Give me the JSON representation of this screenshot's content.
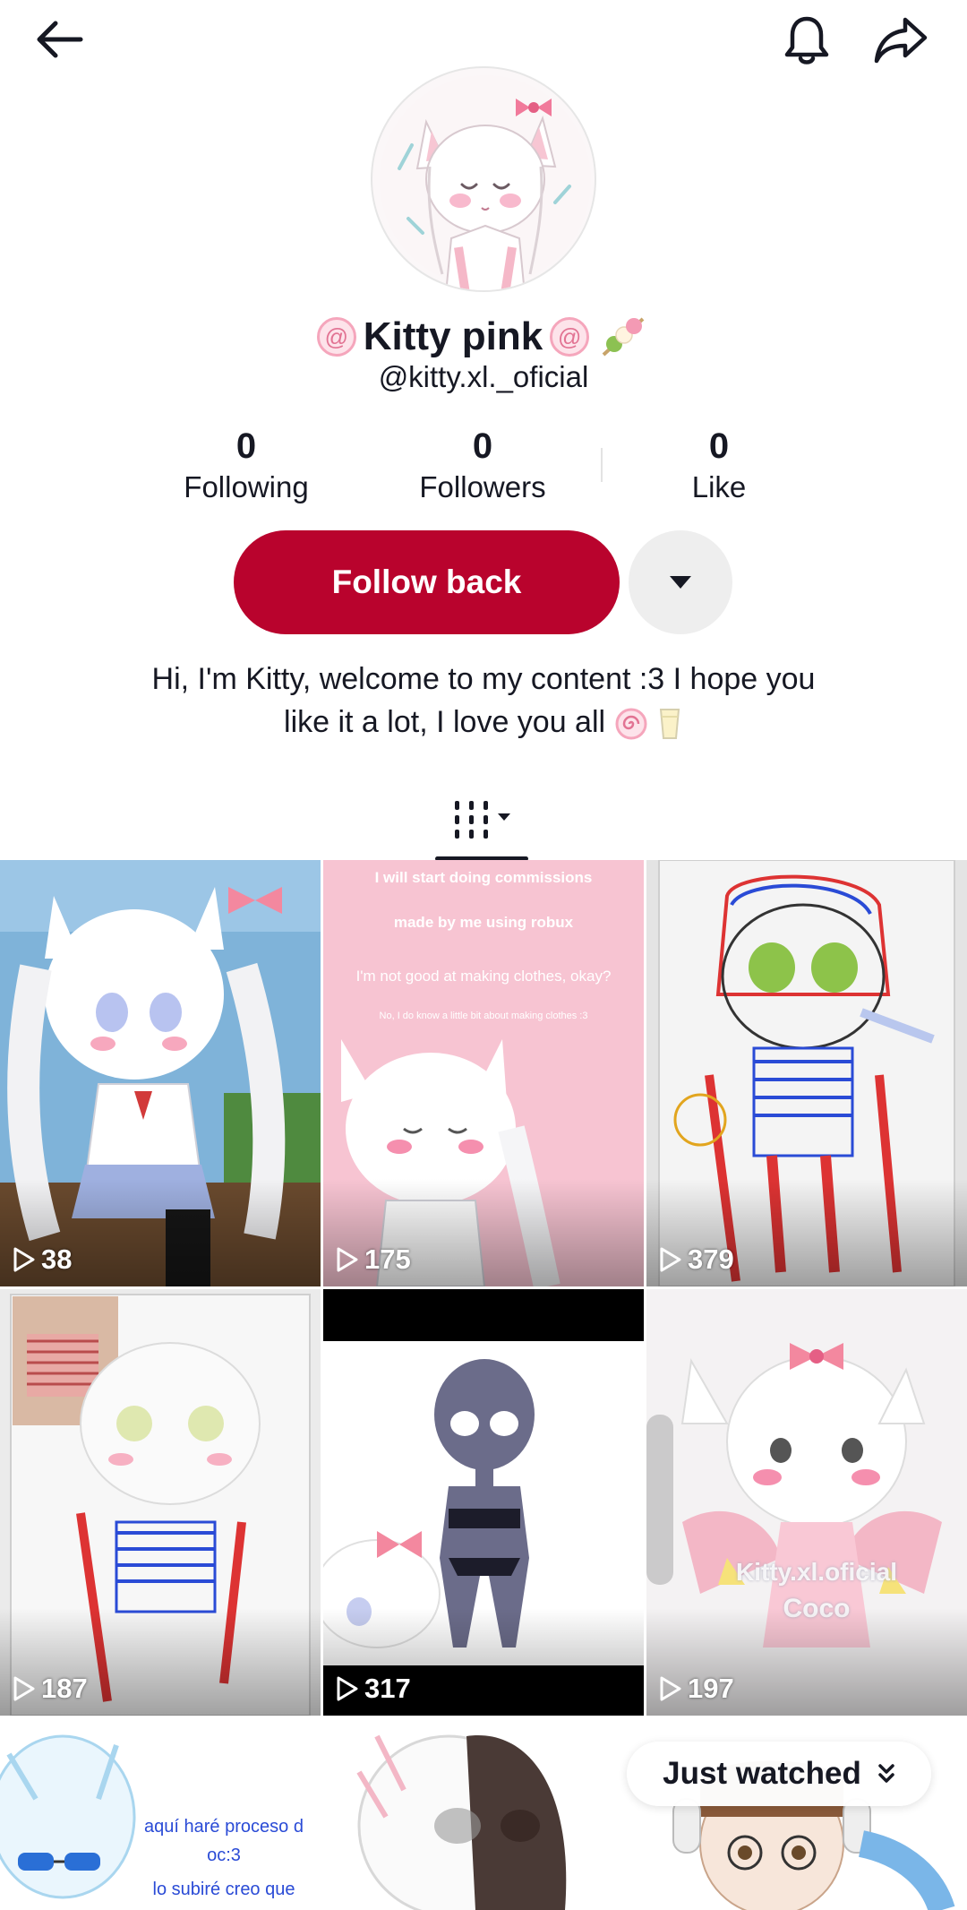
{
  "profile": {
    "display_name": "Kitty pink",
    "handle": "@kitty.xl._oficial",
    "bio_line1": "Hi, I'm Kitty, welcome to my content :3 I hope you",
    "bio_line2": "like it a lot, I love you all"
  },
  "stats": [
    {
      "value": "0",
      "label": "Following"
    },
    {
      "value": "0",
      "label": "Followers"
    },
    {
      "value": "0",
      "label": "Like"
    }
  ],
  "actions": {
    "follow_label": "Follow back"
  },
  "videos": [
    {
      "views": "38"
    },
    {
      "views": "175",
      "overlay_lines": [
        "I will start doing commissions",
        "made by me using robux",
        "I'm not good at making clothes, okay?",
        "No, I do know a little bit about making clothes :3"
      ]
    },
    {
      "views": "379"
    },
    {
      "views": "187"
    },
    {
      "views": "317"
    },
    {
      "views": "197",
      "watermark": "Kitty.xl.oficial",
      "watermark2": "Coco"
    },
    {
      "overlay_lines": [
        "aquí haré proceso d",
        "oc:3",
        "lo subiré creo que"
      ]
    },
    {},
    {}
  ],
  "just_watched_label": "Just watched",
  "colors": {
    "follow_button": "#b9032d",
    "more_button": "#eeeeee",
    "text": "#161823"
  }
}
